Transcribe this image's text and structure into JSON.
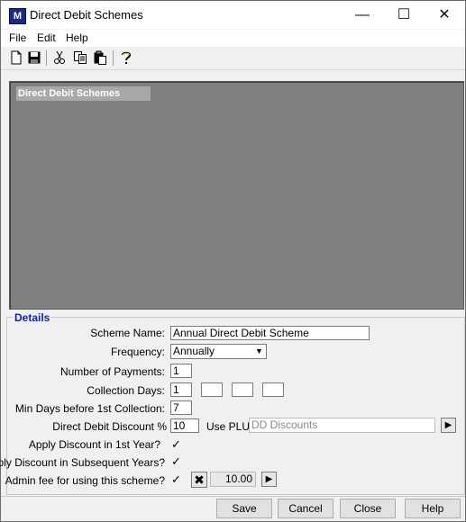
{
  "window": {
    "title": "Direct Debit Schemes",
    "app_icon_text": "M"
  },
  "menu": {
    "file": "File",
    "edit": "Edit",
    "help": "Help"
  },
  "panel": {
    "title": "Direct Debit Schemes"
  },
  "details": {
    "legend": "Details",
    "scheme_name_label": "Scheme Name:",
    "scheme_name_value": "Annual Direct Debit Scheme",
    "frequency_label": "Frequency:",
    "frequency_value": "Annually",
    "num_payments_label": "Number of Payments:",
    "num_payments_value": "1",
    "collection_days_label": "Collection Days:",
    "collection_days_values": [
      "1",
      "",
      "",
      ""
    ],
    "min_days_label": "Min Days before 1st Collection:",
    "min_days_value": "7",
    "dd_discount_label": "Direct Debit Discount %",
    "dd_discount_value": "10",
    "use_plu_label": "Use PLU:",
    "use_plu_value": "DD Discounts",
    "apply_first_year_label": "Apply Discount in 1st Year?",
    "apply_first_year_checked": true,
    "apply_subsequent_label": "Apply Discount in Subsequent Years?",
    "apply_subsequent_checked": true,
    "admin_fee_label": "Admin fee for using this scheme?",
    "admin_fee_checked": true,
    "admin_fee_value": "10.00"
  },
  "buttons": {
    "save": "Save",
    "cancel": "Cancel",
    "close": "Close",
    "help": "Help"
  }
}
